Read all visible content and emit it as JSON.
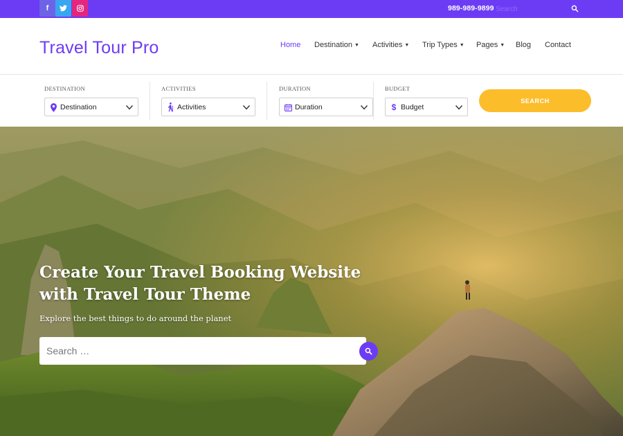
{
  "topbar": {
    "social": [
      {
        "icon": "facebook-icon",
        "glyph": "f",
        "color": "#6c63e6"
      },
      {
        "icon": "twitter-icon",
        "color": "#37a7f1"
      },
      {
        "icon": "instagram-icon",
        "color": "#e5267e"
      }
    ],
    "phone": "989-989-9899",
    "search_placeholder": "Search",
    "search_icon": "search-icon",
    "background": "#6c3cf5"
  },
  "header": {
    "logo": "Travel Tour Pro",
    "nav": [
      {
        "label": "Home",
        "active": true
      },
      {
        "label": "Destination",
        "dropdown": true
      },
      {
        "label": "Activities",
        "dropdown": true
      },
      {
        "label": "Trip Types",
        "dropdown": true
      },
      {
        "label": "Pages",
        "dropdown": true
      },
      {
        "label": "Blog"
      },
      {
        "label": "Contact"
      }
    ],
    "accent": "#6c3cf5"
  },
  "filters": [
    {
      "label": "DESTINATION",
      "value": "Destination",
      "icon": "map-pin-icon"
    },
    {
      "label": "ACTIVITIES",
      "value": "Activities",
      "icon": "hiker-icon"
    },
    {
      "label": "DURATION",
      "value": "Duration",
      "icon": "calendar-icon"
    },
    {
      "label": "BUDGET",
      "value": "Budget",
      "icon": "dollar-icon",
      "glyph": "$"
    }
  ],
  "search_button": {
    "label": "SEARCH",
    "color": "#fbbd2a"
  },
  "hero": {
    "title": "Create Your Travel Booking Website with Travel Tour Theme",
    "subtitle": "Explore the best things to do around the planet",
    "search_placeholder": "Search …",
    "search_icon": "search-icon",
    "search_button_color": "#6c3cf5"
  }
}
